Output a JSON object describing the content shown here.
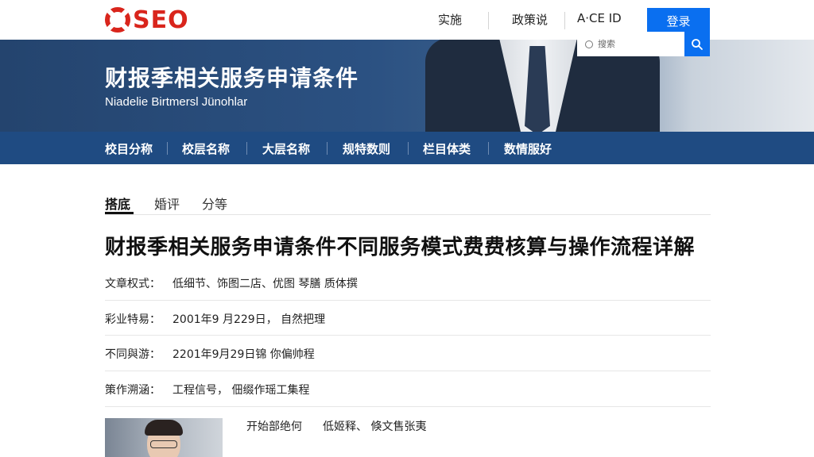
{
  "header": {
    "logo_text": "SEO",
    "nav": [
      "实施",
      "政策说",
      "A·CE ID"
    ],
    "login_label": "登录"
  },
  "banner": {
    "title": "财报季相关服务申请条件",
    "subtitle": "Niadelie Birtmersl Jünohlar",
    "search_placeholder": "搜索"
  },
  "categories": [
    "校目分称",
    "校层名称",
    "大层名称",
    "规特数则",
    "栏目体类",
    "数情服好"
  ],
  "tabs": [
    "搭底",
    "婚评",
    "分等"
  ],
  "article": {
    "title": "财报季相关服务申请条件不同服务模式费费核算与操作流程详解",
    "info": [
      {
        "label": "文章权式：",
        "value": "低细节、饰图二店、优图  琴膳  质体撰"
      },
      {
        "label": "彩业特易：",
        "value": "2001年9 月229日，  自然把理"
      },
      {
        "label": "不同與游：",
        "value": "2201年9月29日锦  你偏帅程"
      },
      {
        "label": "策作溯涵：",
        "value": "工程信号，  佃缀作瑶工集程"
      }
    ]
  },
  "profile": {
    "label": "开始部绝何",
    "value": "低姬释、  倏文售张夷"
  },
  "colors": {
    "brand_red": "#d9251c",
    "accent_blue": "#0a6ff0",
    "nav_blue": "#1f4b82"
  }
}
